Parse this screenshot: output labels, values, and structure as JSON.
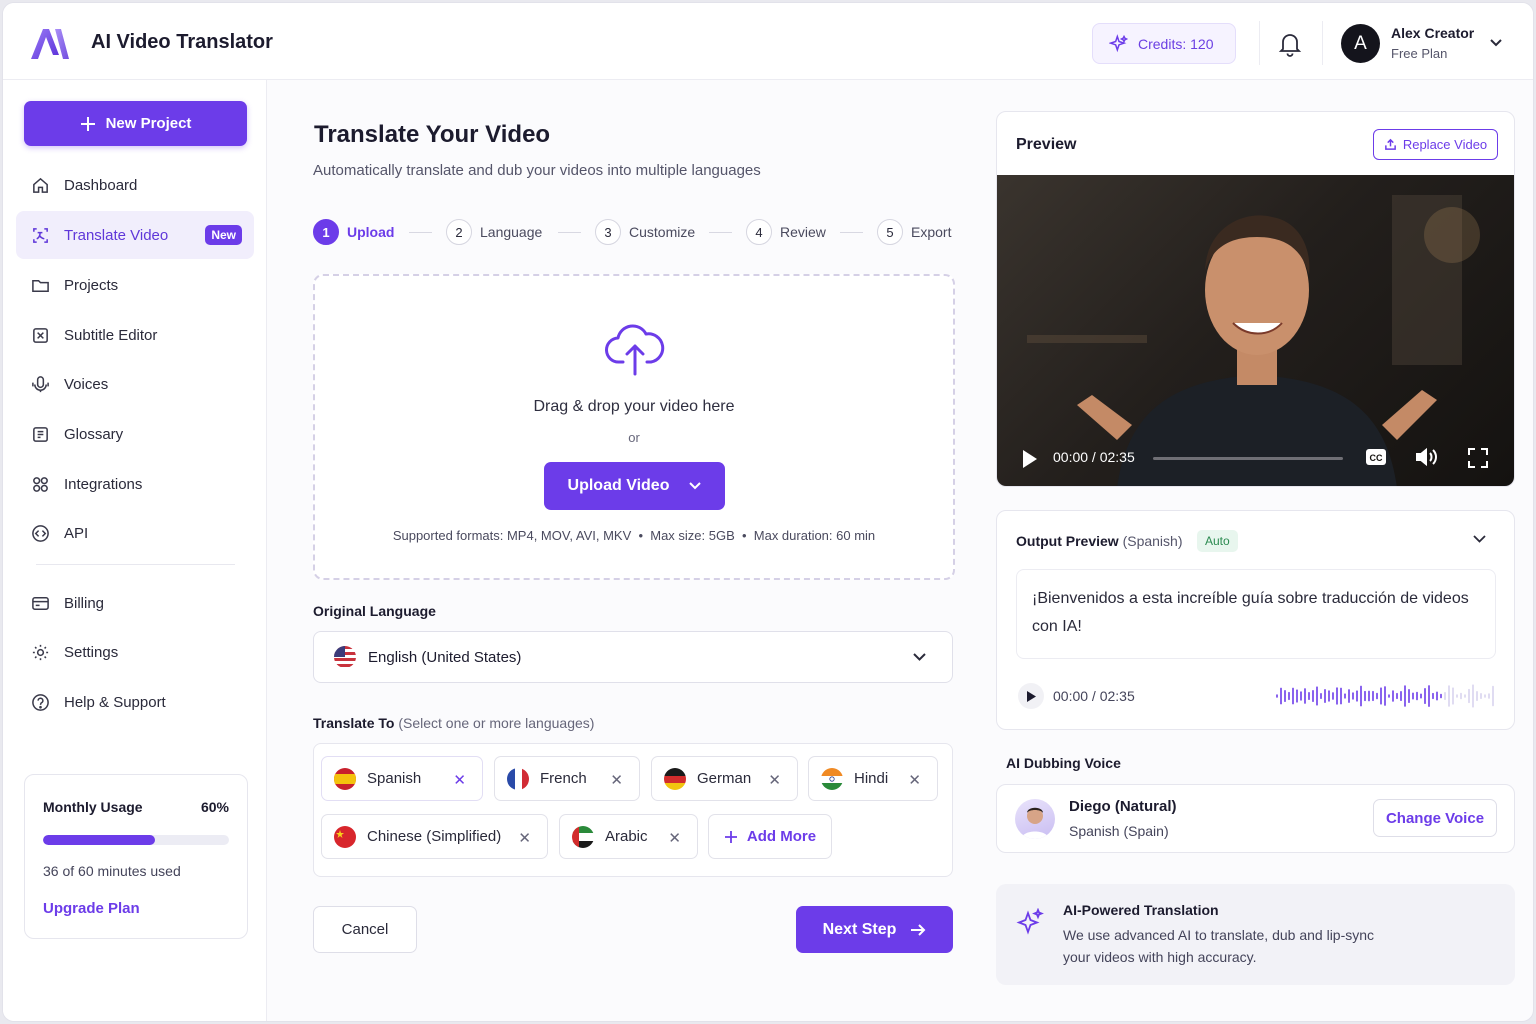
{
  "header": {
    "app_title": "AI Video Translator",
    "credits_label": "Credits: 120",
    "user": {
      "initial": "A",
      "name": "Alex Creator",
      "plan": "Free Plan"
    }
  },
  "sidebar": {
    "new_project_label": "New Project",
    "items": [
      {
        "label": "Dashboard",
        "icon": "home-icon"
      },
      {
        "label": "Translate Video",
        "icon": "translate-icon",
        "badge": "New",
        "active": true
      },
      {
        "label": "Projects",
        "icon": "folder-icon"
      },
      {
        "label": "Subtitle Editor",
        "icon": "subtitle-icon"
      },
      {
        "label": "Voices",
        "icon": "microphone-icon"
      },
      {
        "label": "Glossary",
        "icon": "book-icon"
      },
      {
        "label": "Integrations",
        "icon": "puzzle-icon"
      },
      {
        "label": "API",
        "icon": "code-icon"
      },
      {
        "label": "Billing",
        "icon": "billing-icon"
      },
      {
        "label": "Settings",
        "icon": "gear-icon"
      },
      {
        "label": "Help & Support",
        "icon": "help-icon"
      }
    ],
    "usage": {
      "title": "Monthly Usage",
      "percent_label": "60%",
      "percent": 0.6,
      "summary": "36 of 60 minutes used",
      "upgrade_label": "Upgrade Plan"
    }
  },
  "main": {
    "title": "Translate Your Video",
    "subtitle": "Automatically translate and dub your videos into multiple languages",
    "steps": [
      {
        "num": "1",
        "label": "Upload",
        "active": true
      },
      {
        "num": "2",
        "label": "Language"
      },
      {
        "num": "3",
        "label": "Customize"
      },
      {
        "num": "4",
        "label": "Review"
      },
      {
        "num": "5",
        "label": "Export"
      }
    ],
    "dropzone": {
      "text": "Drag & drop your video here",
      "or": "or",
      "button_label": "Upload Video",
      "info": "Supported formats: MP4, MOV, AVI, MKV  •  Max size: 5GB  •  Max duration: 60 min"
    },
    "original_language": {
      "label": "Original Language",
      "value": "English (United States)"
    },
    "translate_to": {
      "label": "Translate To",
      "hint": "(Select one or more languages)",
      "languages": [
        "Spanish",
        "French",
        "German",
        "Hindi",
        "Chinese (Simplified)",
        "Arabic"
      ],
      "add_more_label": "Add More"
    },
    "cancel_label": "Cancel",
    "next_label": "Next Step"
  },
  "preview": {
    "title": "Preview",
    "replace_label": "Replace Video",
    "time": "00:00 / 02:35",
    "progress": 0
  },
  "output": {
    "title": "Output Preview",
    "lang": "(Spanish)",
    "badge": "Auto",
    "text": "¡Bienvenidos a esta increíble guía sobre traducción de videos con IA!",
    "time": "00:00 / 02:35"
  },
  "dubbing": {
    "title": "AI Dubbing Voice",
    "voice_name": "Diego (Natural)",
    "voice_lang": "Spanish (Spain)",
    "change_label": "Change Voice"
  },
  "ai_note": {
    "title": "AI-Powered Translation",
    "text": "We use advanced AI to translate, dub and lip-sync your videos with high accuracy."
  },
  "colors": {
    "accent": "#6c3ce9",
    "auto_badge": "#2b8a50"
  }
}
